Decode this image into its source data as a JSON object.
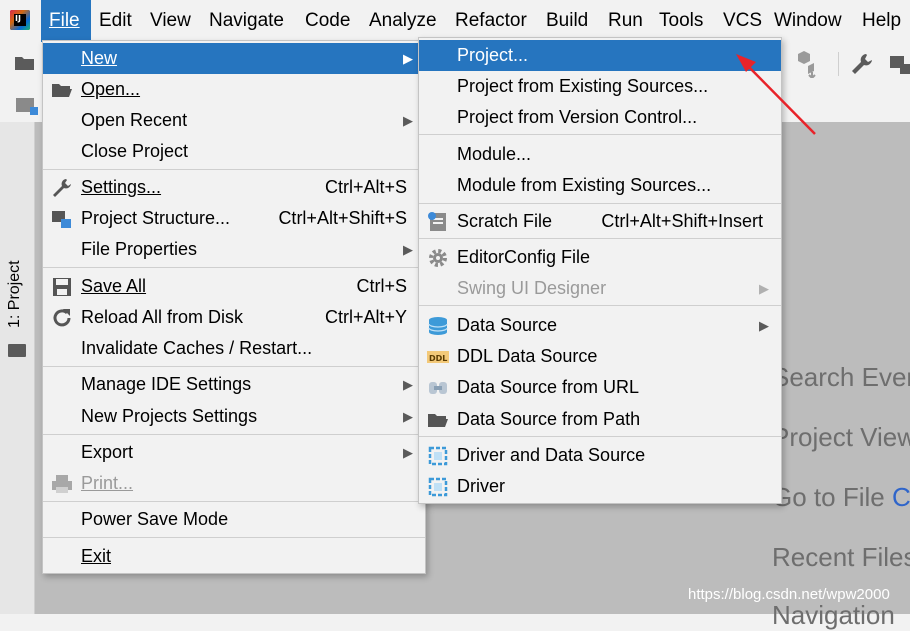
{
  "menubar": {
    "items": [
      "File",
      "Edit",
      "View",
      "Navigate",
      "Code",
      "Analyze",
      "Refactor",
      "Build",
      "Run",
      "Tools",
      "VCS",
      "Window",
      "Help"
    ],
    "active": "File"
  },
  "toolstrip": {
    "label": "1: Project"
  },
  "file_menu": {
    "items": [
      {
        "label": "New",
        "shortcut": "",
        "submenu": true,
        "selected": true,
        "icon": ""
      },
      {
        "label": "Open...",
        "shortcut": "",
        "submenu": false,
        "icon": "folder-open-icon"
      },
      {
        "label": "Open Recent",
        "shortcut": "",
        "submenu": true,
        "icon": ""
      },
      {
        "label": "Close Project",
        "shortcut": "",
        "submenu": false,
        "icon": ""
      },
      {
        "label": "Settings...",
        "shortcut": "Ctrl+Alt+S",
        "submenu": false,
        "icon": "wrench-icon"
      },
      {
        "label": "Project Structure...",
        "shortcut": "Ctrl+Alt+Shift+S",
        "submenu": false,
        "icon": "project-structure-icon"
      },
      {
        "label": "File Properties",
        "shortcut": "",
        "submenu": true,
        "icon": ""
      },
      {
        "label": "Save All",
        "shortcut": "Ctrl+S",
        "submenu": false,
        "icon": "save-icon"
      },
      {
        "label": "Reload All from Disk",
        "shortcut": "Ctrl+Alt+Y",
        "submenu": false,
        "icon": "reload-icon"
      },
      {
        "label": "Invalidate Caches / Restart...",
        "shortcut": "",
        "submenu": false,
        "icon": ""
      },
      {
        "label": "Manage IDE Settings",
        "shortcut": "",
        "submenu": true,
        "icon": ""
      },
      {
        "label": "New Projects Settings",
        "shortcut": "",
        "submenu": true,
        "icon": ""
      },
      {
        "label": "Export",
        "shortcut": "",
        "submenu": true,
        "icon": ""
      },
      {
        "label": "Print...",
        "shortcut": "",
        "submenu": false,
        "disabled": true,
        "icon": "printer-icon"
      },
      {
        "label": "Power Save Mode",
        "shortcut": "",
        "submenu": false,
        "icon": ""
      },
      {
        "label": "Exit",
        "shortcut": "",
        "submenu": false,
        "icon": ""
      }
    ]
  },
  "new_submenu": {
    "items": [
      {
        "label": "Project...",
        "shortcut": "",
        "submenu": false,
        "selected": true,
        "icon": ""
      },
      {
        "label": "Project from Existing Sources...",
        "shortcut": "",
        "submenu": false,
        "icon": ""
      },
      {
        "label": "Project from Version Control...",
        "shortcut": "",
        "submenu": false,
        "icon": ""
      },
      {
        "label": "Module...",
        "shortcut": "",
        "submenu": false,
        "icon": ""
      },
      {
        "label": "Module from Existing Sources...",
        "shortcut": "",
        "submenu": false,
        "icon": ""
      },
      {
        "label": "Scratch File",
        "shortcut": "Ctrl+Alt+Shift+Insert",
        "submenu": false,
        "icon": "scratch-file-icon"
      },
      {
        "label": "EditorConfig File",
        "shortcut": "",
        "submenu": false,
        "icon": "gear-icon"
      },
      {
        "label": "Swing UI Designer",
        "shortcut": "",
        "submenu": true,
        "disabled": true,
        "icon": ""
      },
      {
        "label": "Data Source",
        "shortcut": "",
        "submenu": true,
        "icon": "database-icon"
      },
      {
        "label": "DDL Data Source",
        "shortcut": "",
        "submenu": false,
        "icon": "ddl-icon"
      },
      {
        "label": "Data Source from URL",
        "shortcut": "",
        "submenu": false,
        "icon": "url-datasource-icon"
      },
      {
        "label": "Data Source from Path",
        "shortcut": "",
        "submenu": false,
        "icon": "folder-open-icon"
      },
      {
        "label": "Driver and Data Source",
        "shortcut": "",
        "submenu": false,
        "icon": "driver-icon"
      },
      {
        "label": "Driver",
        "shortcut": "",
        "submenu": false,
        "icon": "driver-icon"
      }
    ]
  },
  "editor_hints": [
    "Search Ever",
    "Project View",
    "Go to File",
    "C",
    "Recent Files",
    "Navigation"
  ],
  "watermark": "https://blog.csdn.net/wpw2000",
  "colors": {
    "selection": "#2675bf",
    "menu_bg": "#f2f2f2",
    "editor_bg": "#bcbcbc",
    "annotation": "#e8232a"
  }
}
